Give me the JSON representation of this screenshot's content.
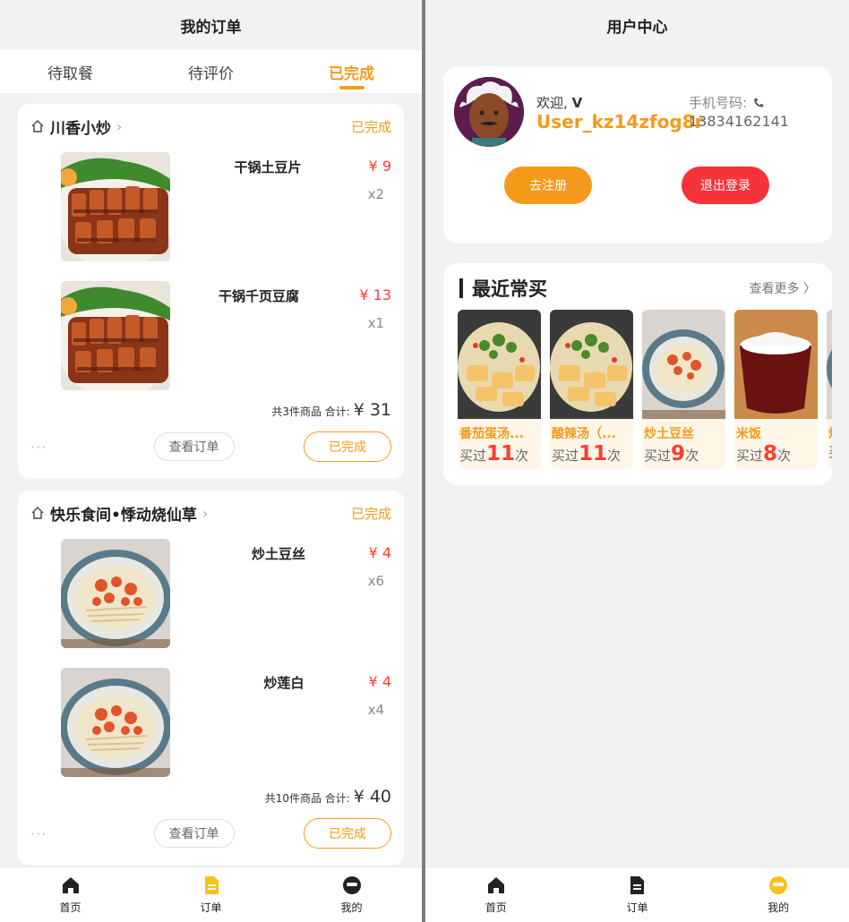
{
  "left": {
    "title": "我的订单",
    "tabs": [
      "待取餐",
      "待评价",
      "已完成"
    ],
    "orders": [
      {
        "shop": "川香小炒",
        "status": "已完成",
        "items": [
          {
            "name": "干锅土豆片",
            "price": "¥ 9",
            "qty": "x2"
          },
          {
            "name": "干锅千页豆腐",
            "price": "¥ 13",
            "qty": "x1"
          }
        ],
        "summary": "共3件商品 合计:",
        "total": "¥ 31",
        "more": "···",
        "view_btn": "查看订单",
        "done_btn": "已完成"
      },
      {
        "shop": "快乐食间•悸动烧仙草",
        "status": "已完成",
        "items": [
          {
            "name": "炒土豆丝",
            "price": "¥ 4",
            "qty": "x6"
          },
          {
            "name": "炒莲白",
            "price": "¥ 4",
            "qty": "x4"
          }
        ],
        "summary": "共10件商品 合计:",
        "total": "¥ 40",
        "more": "···",
        "view_btn": "查看订单",
        "done_btn": "已完成"
      }
    ]
  },
  "right": {
    "title": "用户中心",
    "welcome_prefix": "欢迎,",
    "welcome_name": "V",
    "username": "User_kz14zfog8r",
    "phone_label": "手机号码:",
    "phone": "13834162141",
    "register_btn": "去注册",
    "logout_btn": "退出登录",
    "recent_title": "最近常买",
    "see_more": "查看更多 〉",
    "recent_items": [
      {
        "name": "番茄蛋汤...",
        "prefix": "买过",
        "count": "11",
        "suffix": "次"
      },
      {
        "name": "酸辣汤（...",
        "prefix": "买过",
        "count": "11",
        "suffix": "次"
      },
      {
        "name": "炒土豆丝",
        "prefix": "买过",
        "count": "9",
        "suffix": "次"
      },
      {
        "name": "米饭",
        "prefix": "买过",
        "count": "8",
        "suffix": "次"
      },
      {
        "name": "炒",
        "prefix": "买",
        "count": "",
        "suffix": ""
      }
    ]
  },
  "tabbar": {
    "home": "首页",
    "orders": "订单",
    "mine": "我的"
  },
  "colors": {
    "accent": "#f59a1a",
    "price_red": "#ff3b30",
    "logout_red": "#f5333a"
  }
}
